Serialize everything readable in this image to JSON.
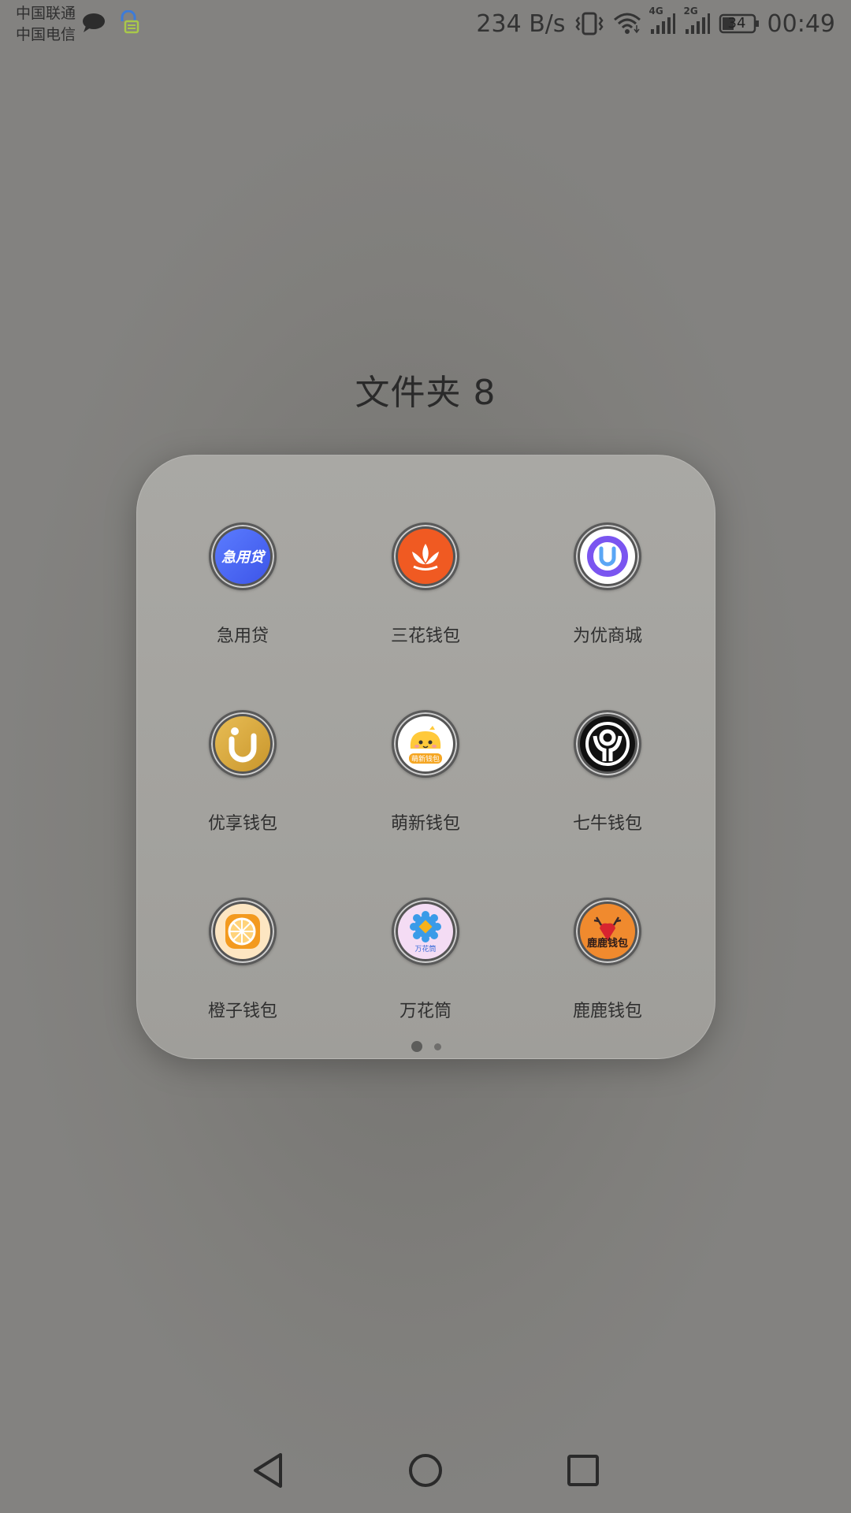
{
  "status_bar": {
    "carrier_1": "中国联通",
    "carrier_2": "中国电信",
    "net_speed": "234 B/s",
    "signal_1_type": "4G",
    "signal_2_type": "2G",
    "battery_level": "34",
    "time": "00:49",
    "left_icons": [
      "message-bubble-icon",
      "vpn-lock-icon"
    ],
    "right_icons": [
      "vibrate-icon",
      "wifi-icon",
      "cell-signal-icon",
      "cell-signal-icon",
      "battery-icon"
    ]
  },
  "folder": {
    "title": "文件夹 8",
    "apps": [
      {
        "label": "急用贷",
        "icon": "jiyongdai-icon",
        "color": "#4a6cf7",
        "icon_text": "急用贷"
      },
      {
        "label": "三花钱包",
        "icon": "sanhua-icon",
        "color": "#f05a22"
      },
      {
        "label": "为优商城",
        "icon": "weiyou-icon",
        "color": "#ffffff"
      },
      {
        "label": "优享钱包",
        "icon": "youxiang-icon",
        "color": "#d9a93d"
      },
      {
        "label": "萌新钱包",
        "icon": "mengxin-icon",
        "color": "#ffffff",
        "icon_text": "萌新钱包"
      },
      {
        "label": "七牛钱包",
        "icon": "qiniu-icon",
        "color": "#111111"
      },
      {
        "label": "橙子钱包",
        "icon": "chengzi-icon",
        "color": "#f39a1e"
      },
      {
        "label": "万花筒",
        "icon": "wanhuatong-icon",
        "color": "#f2d9f2",
        "icon_text": "万花筒"
      },
      {
        "label": "鹿鹿钱包",
        "icon": "lulu-icon",
        "color": "#f08a2e",
        "icon_text": "鹿鹿钱包"
      }
    ],
    "page_count": 2,
    "current_page": 1
  },
  "nav_bar": {
    "buttons": [
      "back-icon",
      "home-icon",
      "recents-icon"
    ]
  }
}
